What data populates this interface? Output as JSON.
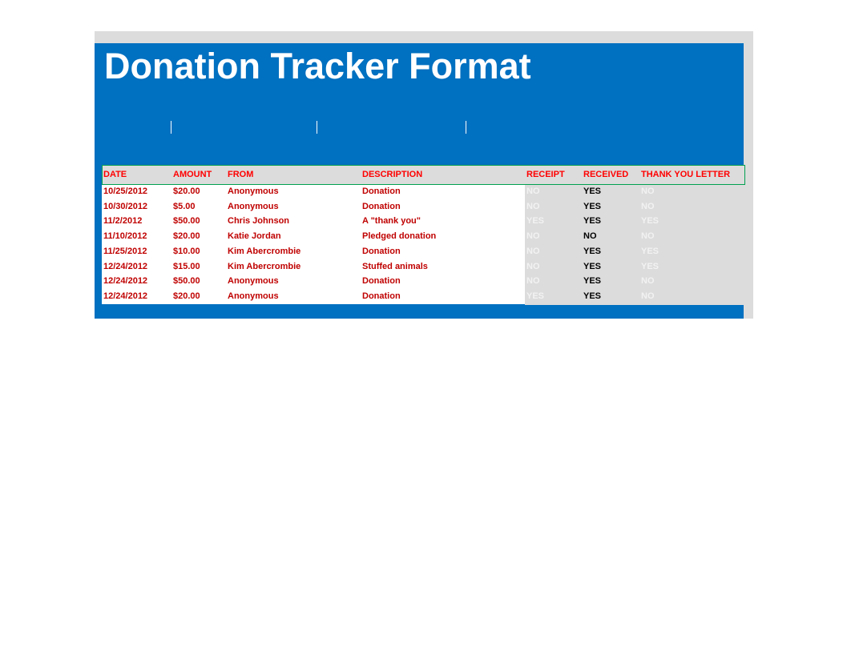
{
  "document": {
    "title": "Donation Tracker Format"
  },
  "colors": {
    "banner": "#0070c0",
    "header_text": "#ff0000",
    "row_text": "#c00000",
    "status_bg": "#dcdcdc",
    "header_border": "#00a050"
  },
  "table": {
    "headers": {
      "date": "DATE",
      "amount": "AMOUNT",
      "from": "FROM",
      "description": "DESCRIPTION",
      "receipt": "RECEIPT",
      "received": "RECEIVED",
      "thank_you_letter": "THANK YOU LETTER"
    },
    "rows": [
      {
        "date": "10/25/2012",
        "amount": "$20.00",
        "from": "Anonymous",
        "description": "Donation",
        "receipt": "NO",
        "received": "YES",
        "thank_you_letter": "NO"
      },
      {
        "date": "10/30/2012",
        "amount": "$5.00",
        "from": "Anonymous",
        "description": "Donation",
        "receipt": "NO",
        "received": "YES",
        "thank_you_letter": "NO"
      },
      {
        "date": "11/2/2012",
        "amount": "$50.00",
        "from": "Chris Johnson",
        "description": "A \"thank you\"",
        "receipt": "YES",
        "received": "YES",
        "thank_you_letter": "YES"
      },
      {
        "date": "11/10/2012",
        "amount": "$20.00",
        "from": "Katie Jordan",
        "description": "Pledged donation",
        "receipt": "NO",
        "received": "NO",
        "thank_you_letter": "NO"
      },
      {
        "date": "11/25/2012",
        "amount": "$10.00",
        "from": "Kim Abercrombie",
        "description": "Donation",
        "receipt": "NO",
        "received": "YES",
        "thank_you_letter": "YES"
      },
      {
        "date": "12/24/2012",
        "amount": "$15.00",
        "from": "Kim Abercrombie",
        "description": "Stuffed animals",
        "receipt": "NO",
        "received": "YES",
        "thank_you_letter": "YES"
      },
      {
        "date": "12/24/2012",
        "amount": "$50.00",
        "from": "Anonymous",
        "description": "Donation",
        "receipt": "NO",
        "received": "YES",
        "thank_you_letter": "NO"
      },
      {
        "date": "12/24/2012",
        "amount": "$20.00",
        "from": "Anonymous",
        "description": "Donation",
        "receipt": "YES",
        "received": "YES",
        "thank_you_letter": "NO"
      }
    ]
  }
}
